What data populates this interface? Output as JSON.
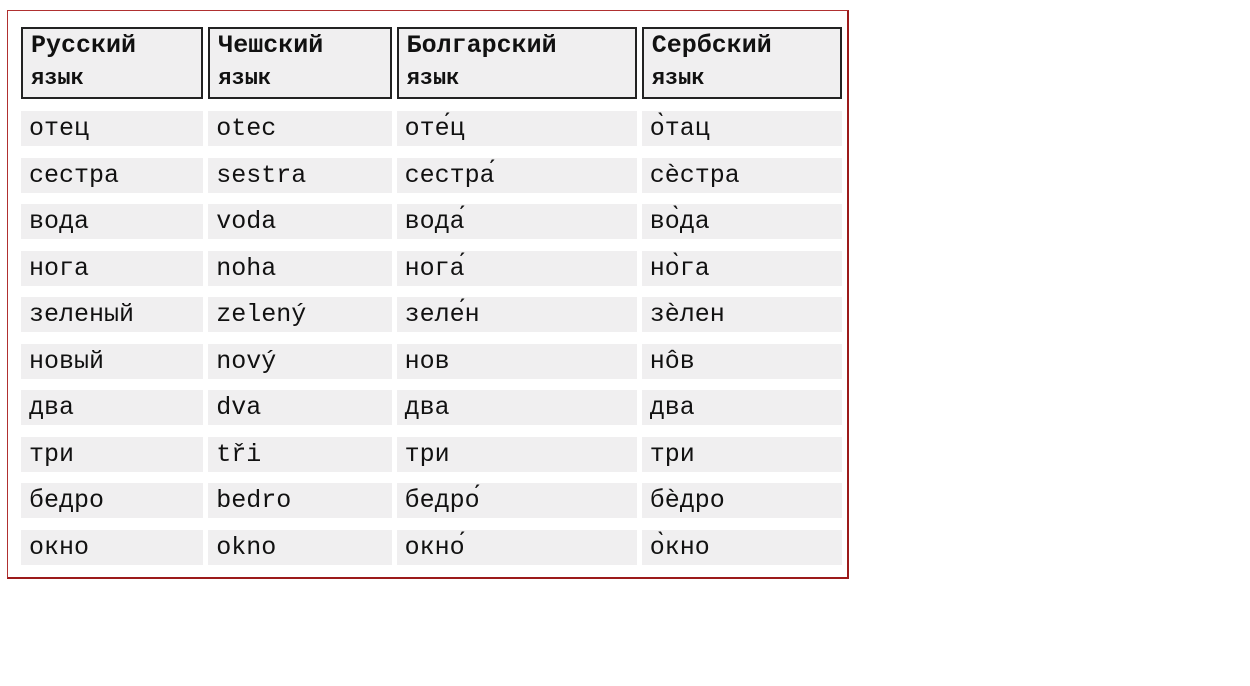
{
  "headers": [
    {
      "line1": "Русский",
      "line2": "язык"
    },
    {
      "line1": "Чешский",
      "line2": "язык"
    },
    {
      "line1": "Болгарский",
      "line2": "язык"
    },
    {
      "line1": "Сербский",
      "line2": "язык"
    }
  ],
  "rows": [
    [
      "отец",
      "otec",
      "оте́ц",
      "о̀тац"
    ],
    [
      "сестра",
      "sestra",
      "сестра́",
      "сѐстра"
    ],
    [
      "вода",
      "voda",
      "вода́",
      "во̀да"
    ],
    [
      "нога",
      "noha",
      "нога́",
      "но̀га"
    ],
    [
      "зеленый",
      "zelený",
      "зеле́н",
      "зѐлен"
    ],
    [
      "новый",
      "nový",
      "нов",
      "нôв"
    ],
    [
      "два",
      "dva",
      "два",
      "два"
    ],
    [
      "три",
      "tři",
      "три",
      "три"
    ],
    [
      "бедро",
      "bedro",
      "бедро́",
      "бѐдро"
    ],
    [
      "окно",
      "okno",
      "окно́",
      "о̀кно"
    ]
  ],
  "colors": {
    "frame_border": "#9c1a1a",
    "cell_bg": "#f0eff0",
    "header_border": "#222222"
  }
}
